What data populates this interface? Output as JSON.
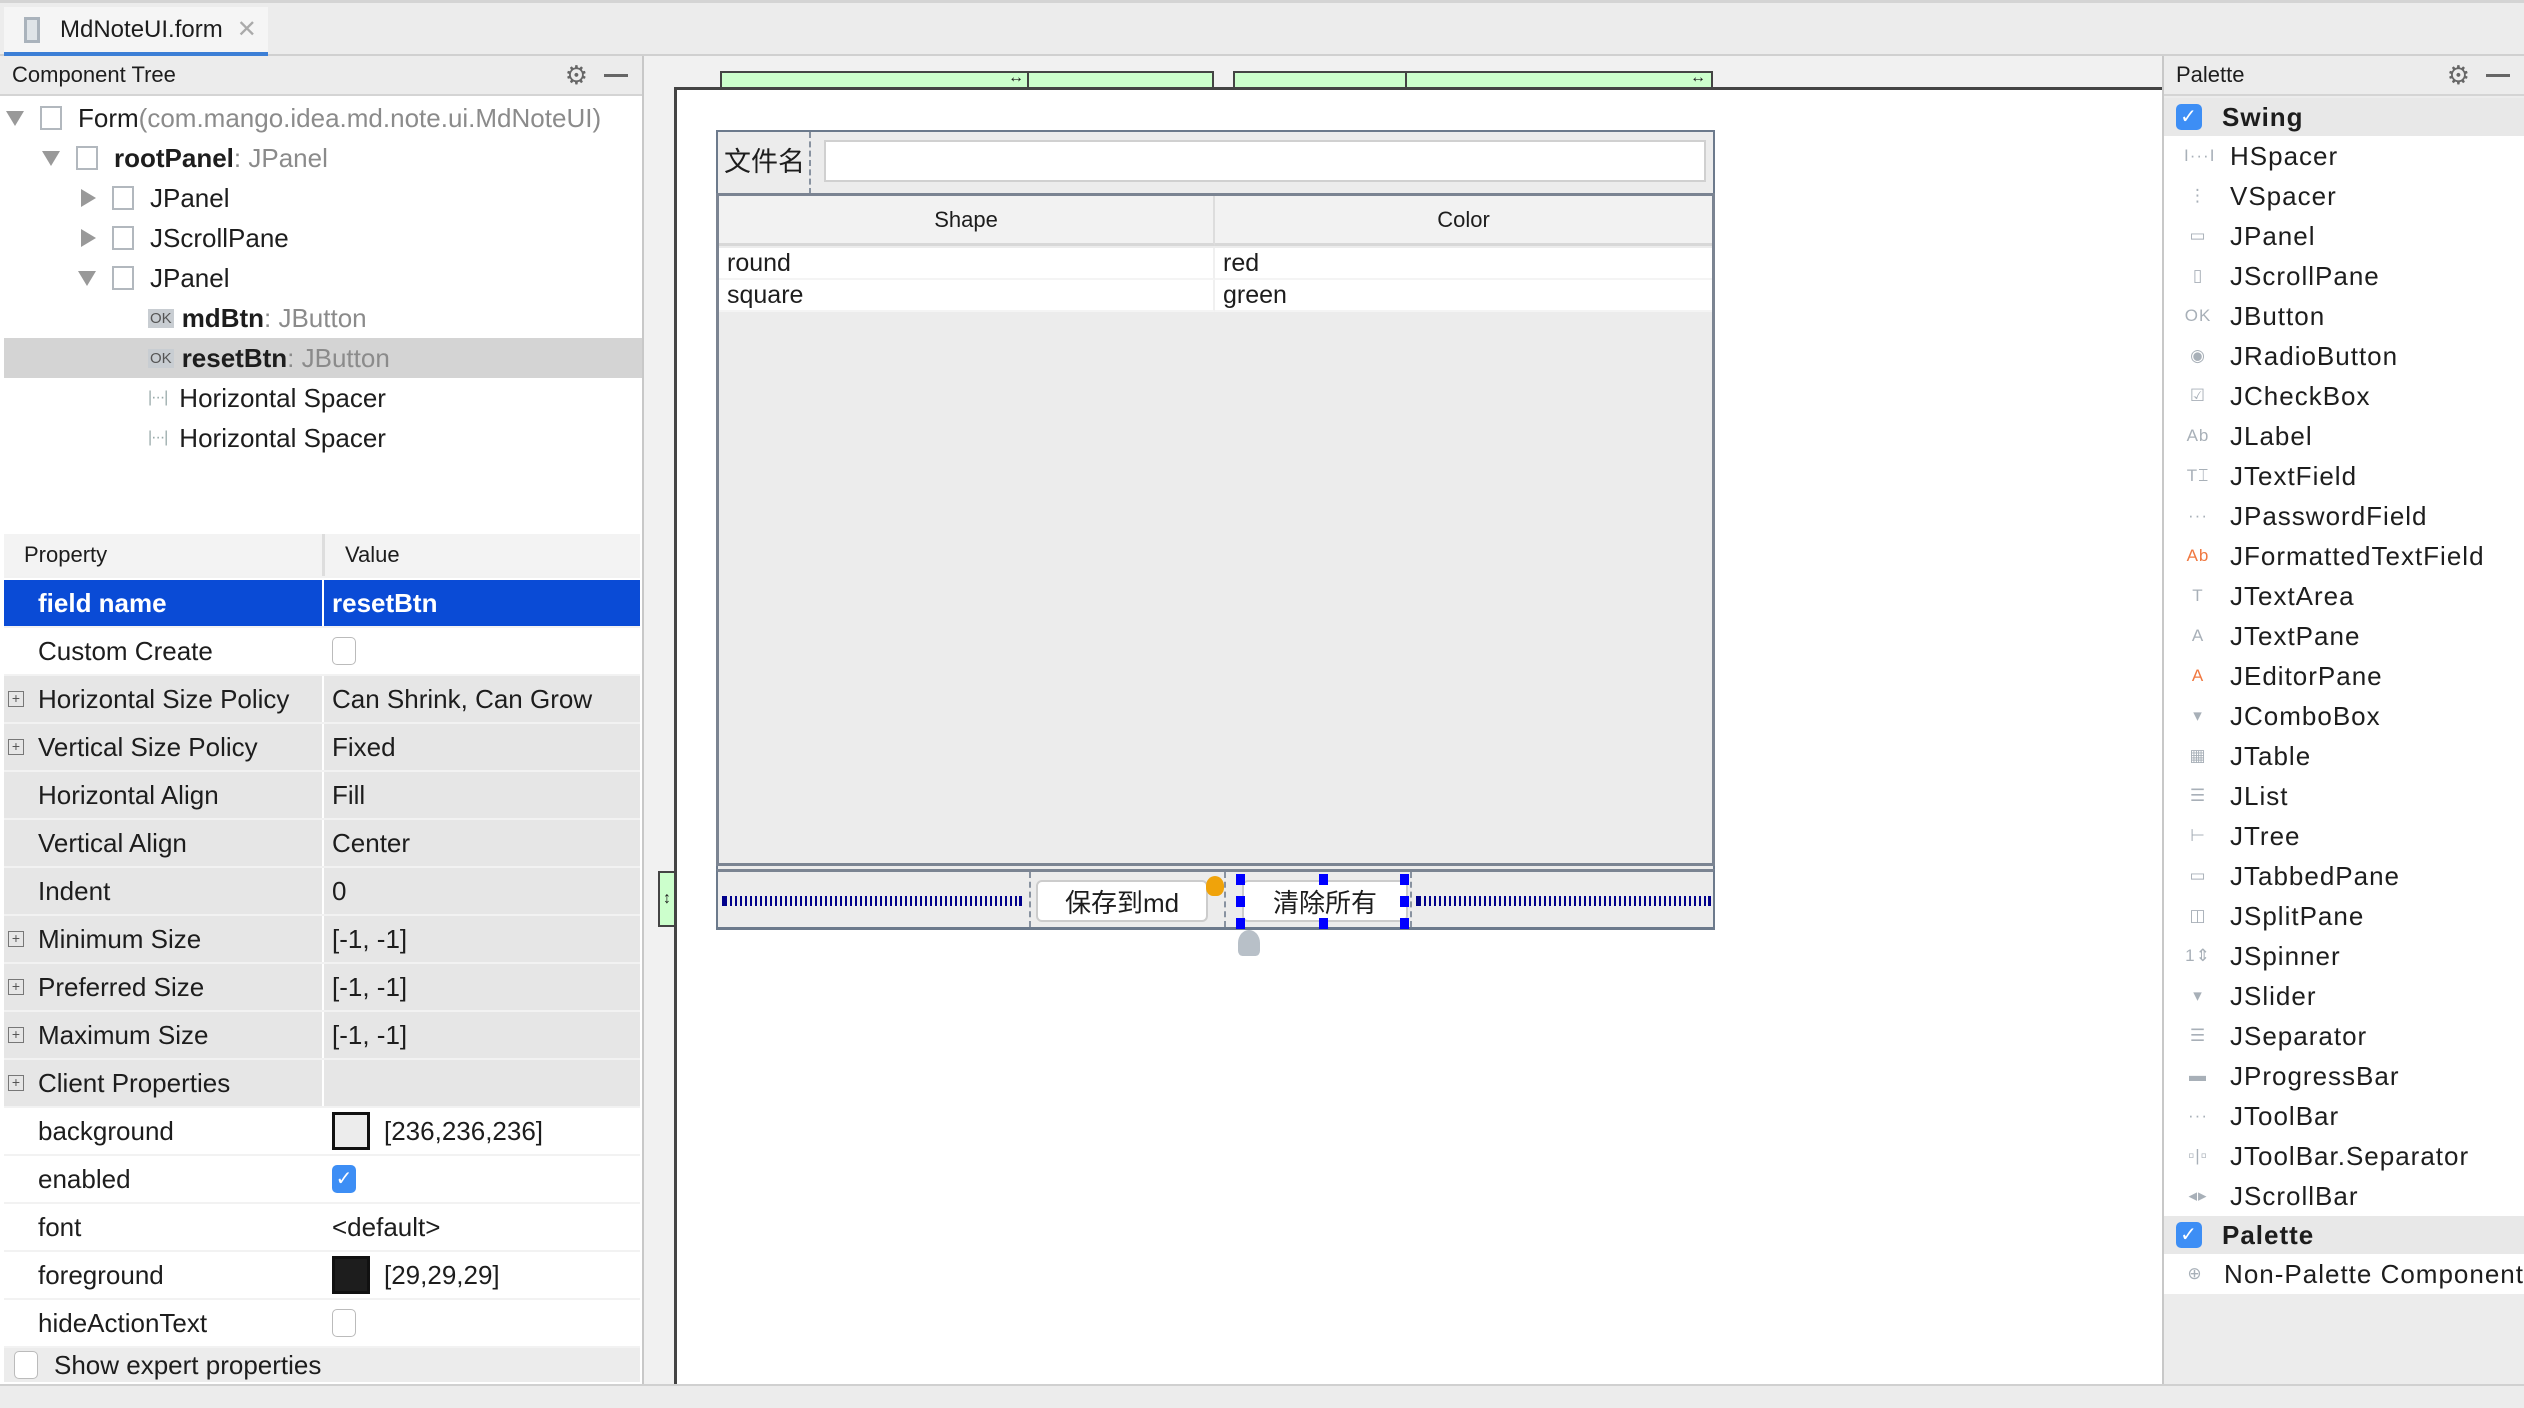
{
  "tab": {
    "title": "MdNoteUI.form"
  },
  "component_tree": {
    "title": "Component Tree",
    "rows": [
      {
        "indent": 0,
        "toggle": "down",
        "icon": "checkbox",
        "name": "Form",
        "type": " (com.mango.idea.md.note.ui.MdNoteUI)",
        "bold": false
      },
      {
        "indent": 1,
        "toggle": "down",
        "icon": "checkbox",
        "name": "rootPanel",
        "type": " : JPanel",
        "bold": true
      },
      {
        "indent": 2,
        "toggle": "right",
        "icon": "checkbox",
        "name": "JPanel",
        "type": "",
        "bold": false
      },
      {
        "indent": 2,
        "toggle": "right",
        "icon": "checkbox",
        "name": "JScrollPane",
        "type": "",
        "bold": false
      },
      {
        "indent": 2,
        "toggle": "down",
        "icon": "checkbox",
        "name": "JPanel",
        "type": "",
        "bold": false
      },
      {
        "indent": 3,
        "toggle": "",
        "icon": "ok",
        "name": "mdBtn",
        "type": " : JButton",
        "bold": true
      },
      {
        "indent": 3,
        "toggle": "",
        "icon": "ok",
        "name": "resetBtn",
        "type": " : JButton",
        "bold": true,
        "selected": true
      },
      {
        "indent": 3,
        "toggle": "",
        "icon": "spacer",
        "name": "Horizontal Spacer",
        "type": "",
        "bold": false
      },
      {
        "indent": 3,
        "toggle": "",
        "icon": "spacer",
        "name": "Horizontal Spacer",
        "type": "",
        "bold": false
      }
    ]
  },
  "properties": {
    "col_property": "Property",
    "col_value": "Value",
    "rows": [
      {
        "name": "field name",
        "value": "resetBtn",
        "selected": true
      },
      {
        "name": "Custom Create",
        "checkbox": false,
        "white": true
      },
      {
        "name": "Horizontal Size Policy",
        "value": "Can Shrink, Can Grow",
        "expand": true
      },
      {
        "name": "Vertical Size Policy",
        "value": "Fixed",
        "expand": true
      },
      {
        "name": "Horizontal Align",
        "value": "Fill"
      },
      {
        "name": "Vertical Align",
        "value": "Center"
      },
      {
        "name": "Indent",
        "value": "0"
      },
      {
        "name": "Minimum Size",
        "value": "[-1, -1]",
        "expand": true
      },
      {
        "name": "Preferred Size",
        "value": "[-1, -1]",
        "expand": true
      },
      {
        "name": "Maximum Size",
        "value": "[-1, -1]",
        "expand": true
      },
      {
        "name": "Client Properties",
        "value": "",
        "expand": true
      },
      {
        "name": "background",
        "value": "[236,236,236]",
        "swatch": "#ececec",
        "white": true
      },
      {
        "name": "enabled",
        "checkbox": true,
        "white": true
      },
      {
        "name": "font",
        "value": "<default>",
        "white": true
      },
      {
        "name": "foreground",
        "value": "[29,29,29]",
        "swatch": "#1d1d1d",
        "white": true
      },
      {
        "name": "hideActionText",
        "checkbox": false,
        "white": true
      }
    ],
    "show_expert": "Show expert properties"
  },
  "form": {
    "label": "文件名",
    "text_field_value": "",
    "table": {
      "columns": [
        "Shape",
        "Color"
      ],
      "rows": [
        [
          "round",
          "red"
        ],
        [
          "square",
          "green"
        ]
      ]
    },
    "buttons": {
      "save": "保存到md",
      "reset": "清除所有"
    }
  },
  "palette": {
    "title": "Palette",
    "groups": [
      {
        "name": "Swing",
        "items": [
          {
            "label": "HSpacer",
            "icon": "I···I"
          },
          {
            "label": "VSpacer",
            "icon": "⋮"
          },
          {
            "label": "JPanel",
            "icon": "▭"
          },
          {
            "label": "JScrollPane",
            "icon": "▯"
          },
          {
            "label": "JButton",
            "icon": "OK"
          },
          {
            "label": "JRadioButton",
            "icon": "◉"
          },
          {
            "label": "JCheckBox",
            "icon": "☑"
          },
          {
            "label": "JLabel",
            "icon": "Ab"
          },
          {
            "label": "JTextField",
            "icon": "T⌶"
          },
          {
            "label": "JPasswordField",
            "icon": "···"
          },
          {
            "label": "JFormattedTextField",
            "icon": "Ab"
          },
          {
            "label": "JTextArea",
            "icon": "T"
          },
          {
            "label": "JTextPane",
            "icon": "A"
          },
          {
            "label": "JEditorPane",
            "icon": "A"
          },
          {
            "label": "JComboBox",
            "icon": "▾"
          },
          {
            "label": "JTable",
            "icon": "▦"
          },
          {
            "label": "JList",
            "icon": "☰"
          },
          {
            "label": "JTree",
            "icon": "⊢"
          },
          {
            "label": "JTabbedPane",
            "icon": "▭"
          },
          {
            "label": "JSplitPane",
            "icon": "◫"
          },
          {
            "label": "JSpinner",
            "icon": "1⇕"
          },
          {
            "label": "JSlider",
            "icon": "▾"
          },
          {
            "label": "JSeparator",
            "icon": "☰"
          },
          {
            "label": "JProgressBar",
            "icon": "▬"
          },
          {
            "label": "JToolBar",
            "icon": "···"
          },
          {
            "label": "JToolBar.Separator",
            "icon": "▫|▫"
          },
          {
            "label": "JScrollBar",
            "icon": "◂▸"
          }
        ]
      },
      {
        "name": "Palette",
        "items": [
          {
            "label": "Non-Palette Component",
            "icon": "⊕"
          }
        ]
      }
    ]
  },
  "colors": {
    "accent": "#0a4bd6",
    "tab_underline": "#3c7fd6",
    "checkbox": "#3d8ef5",
    "guide_green": "#ccffcc",
    "selection_handle": "#0000ff",
    "bulb": "#f0a30a"
  }
}
